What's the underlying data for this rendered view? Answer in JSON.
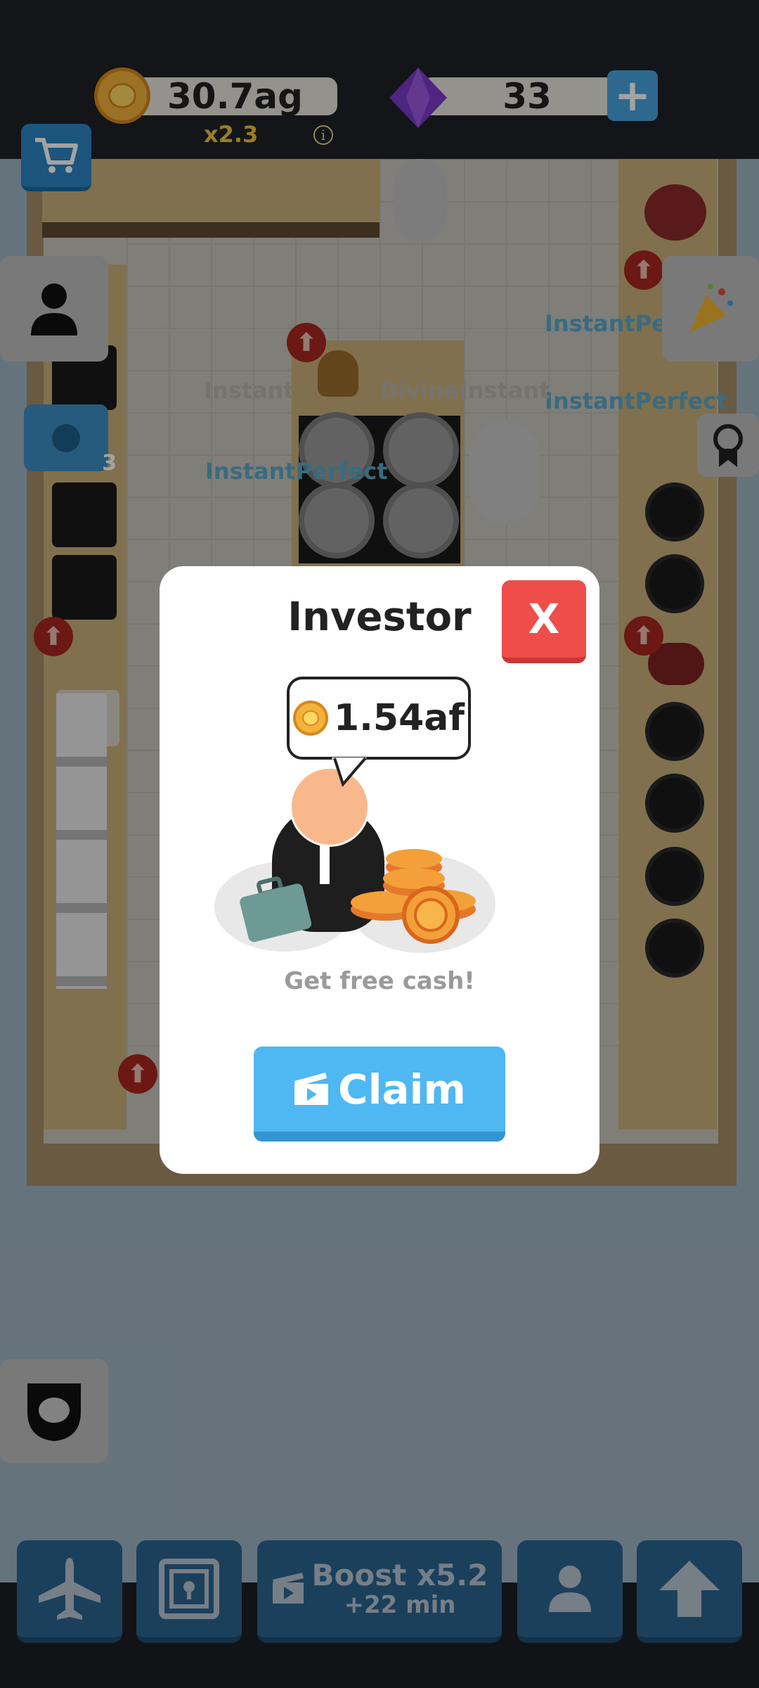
{
  "topbar": {
    "coins_value": "30.7ag",
    "coins_multiplier": "x2.3",
    "gems_value": "33",
    "info_label": "i"
  },
  "world": {
    "station_labels": [
      "InstantPerfect",
      "InstantPerfect",
      "InstantPerfect",
      "Instant",
      "DivineInstant"
    ],
    "camera_count": "3"
  },
  "modal": {
    "title": "Investor",
    "close_label": "X",
    "reward_amount": "1.54af",
    "subtitle": "Get free cash!",
    "claim_label": "Claim"
  },
  "bottombar": {
    "boost_title": "Boost x5.2",
    "boost_time": "+22 min"
  },
  "colors": {
    "topbar_bg": "#1f2227",
    "modal_bg": "#ffffff",
    "close_red": "#ef4d4a",
    "claim_blue": "#4fb7f2",
    "coin_gold": "#f3b23a",
    "gem_purple": "#7b3bc9",
    "bottom_button_blue": "#2b6591"
  },
  "icons": [
    "coin-icon",
    "gem-icon",
    "plus-icon",
    "cart-icon",
    "profile-icon",
    "camera-icon",
    "party-popper-icon",
    "achievement-badge-icon",
    "shield-icon",
    "airplane-icon",
    "safe-icon",
    "video-ad-icon",
    "person-icon",
    "upgrade-arrow-icon"
  ]
}
